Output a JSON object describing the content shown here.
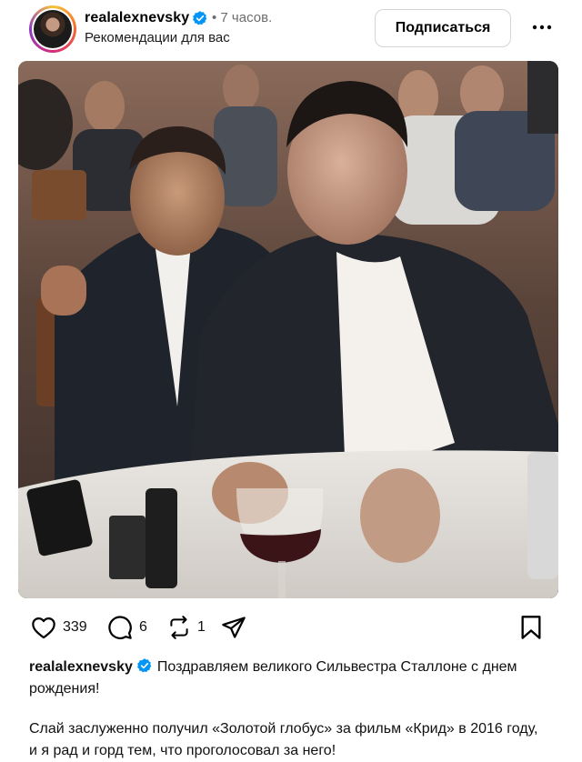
{
  "post": {
    "username": "realalexnevsky",
    "time": "• 7 часов.",
    "subtitle": "Рекомендации для вас",
    "follow_label": "Подписаться"
  },
  "icons": {
    "avatar": "avatar-photo",
    "verified": "verified-badge-icon",
    "more": "more-dots-icon",
    "like": "heart-icon",
    "comment": "comment-bubble-icon",
    "repost": "repost-icon",
    "share": "send-icon",
    "save": "bookmark-icon"
  },
  "actions": {
    "likes": "339",
    "comments": "6",
    "reposts": "1"
  },
  "caption": {
    "username": "realalexnevsky",
    "line1": "Поздравляем великого Сильвестра Сталлоне с днем рождения!",
    "line2": "Слай заслуженно получил «Золотой глобус» за фильм «Крид» в 2016 году, и я рад и горд тем, что проголосовал за него!"
  },
  "colors": {
    "verified_blue": "#0095f6",
    "muted_text": "#6d6d6d"
  }
}
